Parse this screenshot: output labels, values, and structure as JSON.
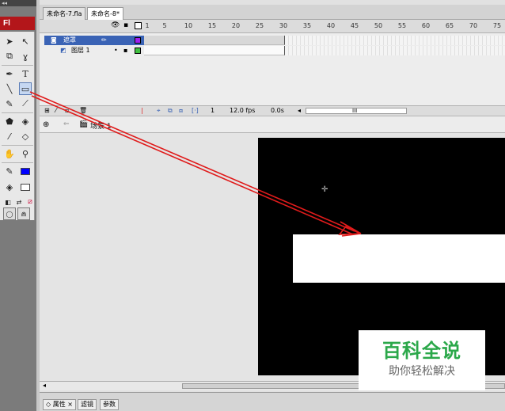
{
  "tools_panel": {
    "top_label": "◂◂",
    "logo": "Fl",
    "tools": [
      {
        "name": "selection-tool",
        "icon": "arrow-icon",
        "glyph": "➤"
      },
      {
        "name": "subselection-tool",
        "icon": "subselect-icon",
        "glyph": "↖"
      },
      {
        "name": "free-transform-tool",
        "icon": "transform-icon",
        "glyph": "⧉"
      },
      {
        "name": "lasso-tool",
        "icon": "lasso-icon",
        "glyph": "ɣ"
      },
      {
        "name": "pen-tool",
        "icon": "pen-icon",
        "glyph": "✒"
      },
      {
        "name": "text-tool",
        "icon": "text-icon",
        "glyph": "T"
      },
      {
        "name": "line-tool",
        "icon": "line-icon",
        "glyph": "╲"
      },
      {
        "name": "rectangle-tool",
        "icon": "rectangle-icon",
        "glyph": "▭"
      },
      {
        "name": "pencil-tool",
        "icon": "pencil-icon",
        "glyph": "✎"
      },
      {
        "name": "brush-tool",
        "icon": "brush-icon",
        "glyph": "⟋"
      },
      {
        "name": "ink-bottle-tool",
        "icon": "ink-bottle-icon",
        "glyph": "⬟"
      },
      {
        "name": "paint-bucket-tool",
        "icon": "paint-bucket-icon",
        "glyph": "◈"
      },
      {
        "name": "eyedropper-tool",
        "icon": "eyedropper-icon",
        "glyph": "⁄"
      },
      {
        "name": "eraser-tool",
        "icon": "eraser-icon",
        "glyph": "◇"
      },
      {
        "name": "hand-tool",
        "icon": "hand-icon",
        "glyph": "✋"
      },
      {
        "name": "zoom-tool",
        "icon": "zoom-icon",
        "glyph": "⚲"
      }
    ],
    "stroke_color": "#0000ff",
    "fill_color": "#ffffff"
  },
  "tabs": [
    {
      "label": "未命名-7.fla",
      "active": false
    },
    {
      "label": "未命名-8*",
      "active": true
    }
  ],
  "timeline": {
    "ruler": [
      "1",
      "5",
      "10",
      "15",
      "20",
      "25",
      "30",
      "35",
      "40",
      "45",
      "50",
      "55",
      "60",
      "65",
      "70",
      "75"
    ],
    "layers": [
      {
        "name": "遮罩",
        "selected": true,
        "color": "#a020f0"
      },
      {
        "name": "图层 1",
        "selected": false,
        "color": "#40c040"
      }
    ],
    "current_frame": "1",
    "frame_rate": "12.0 fps",
    "elapsed": "0.0s",
    "scroll_thumb": "III"
  },
  "editbar": {
    "scene": "场景 1"
  },
  "bottom_tabs": [
    "属性 ×",
    "滤镜",
    "参数"
  ],
  "watermark": {
    "title": "百科全说",
    "subtitle": "助你轻松解决"
  },
  "colors": {
    "annotation_arrow": "#e01b1b",
    "stage": "#000000",
    "layer_selected": "#3a63b5"
  }
}
